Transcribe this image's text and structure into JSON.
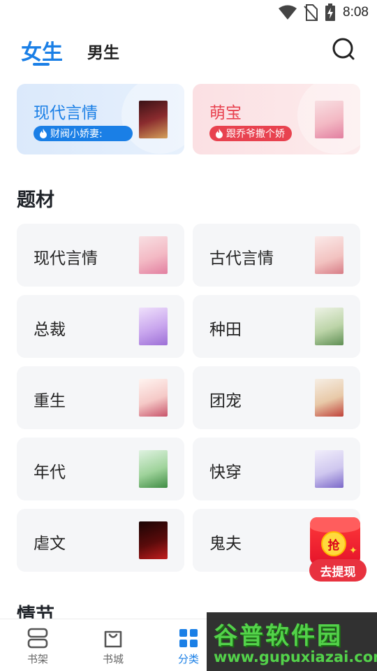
{
  "status_bar": {
    "time": "8:08"
  },
  "header": {
    "tabs": [
      {
        "label": "女生",
        "active": true
      },
      {
        "label": "男生",
        "active": false
      }
    ]
  },
  "featured": [
    {
      "title": "现代言情",
      "tag": "财阀小娇妻:",
      "accent": "#1a7fe6"
    },
    {
      "title": "萌宝",
      "tag": "跟乔爷撒个娇",
      "accent": "#e8424f"
    }
  ],
  "sections": {
    "topics_title": "题材",
    "plot_title": "情节"
  },
  "topics": [
    {
      "label": "现代言情"
    },
    {
      "label": "古代言情"
    },
    {
      "label": "总裁"
    },
    {
      "label": "种田"
    },
    {
      "label": "重生"
    },
    {
      "label": "团宠"
    },
    {
      "label": "年代"
    },
    {
      "label": "快穿"
    },
    {
      "label": "虐文"
    },
    {
      "label": "鬼夫"
    }
  ],
  "red_packet": {
    "coin_text": "抢",
    "button_label": "去提现"
  },
  "bottom_nav": [
    {
      "label": "书架",
      "icon": "bookshelf-icon",
      "active": false
    },
    {
      "label": "书城",
      "icon": "bookstore-icon",
      "active": false
    },
    {
      "label": "分类",
      "icon": "category-icon",
      "active": true
    }
  ],
  "watermark": {
    "brand": "谷普软件园",
    "url": "www.gupuxiazai.com"
  },
  "colors": {
    "accent_blue": "#1a7fe6",
    "accent_red": "#e8424f",
    "card_bg": "#f5f6f8"
  }
}
